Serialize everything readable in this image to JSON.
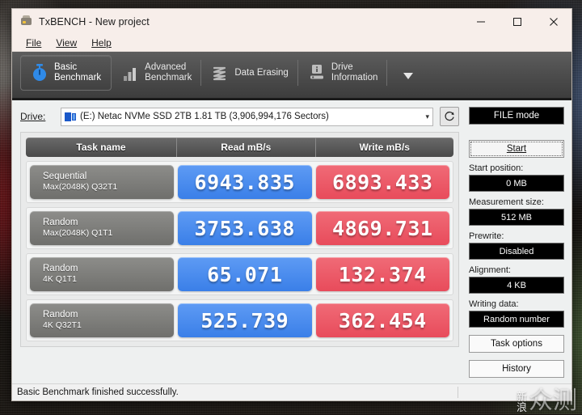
{
  "window": {
    "title": "TxBENCH - New project",
    "app_icon": "printer-icon",
    "controls": {
      "minimize": "minimize-icon",
      "maximize": "maximize-icon",
      "close": "close-icon"
    }
  },
  "menu": {
    "items": [
      "File",
      "View",
      "Help"
    ]
  },
  "tabs": [
    {
      "label": "Basic\nBenchmark",
      "icon": "stopwatch-icon",
      "active": true
    },
    {
      "label": "Advanced\nBenchmark",
      "icon": "bar-chart-icon",
      "active": false
    },
    {
      "label": "Data Erasing",
      "icon": "eraser-wave-icon",
      "active": false
    },
    {
      "label": "Drive\nInformation",
      "icon": "drive-info-icon",
      "active": false
    }
  ],
  "tab_overflow_icon": "chevron-down-icon",
  "drive": {
    "label": "Drive:",
    "value": "(E:) Netac NVMe SSD 2TB  1.81 TB (3,906,994,176 Sectors)",
    "dropdown_icon": "chevron-down-icon",
    "refresh_icon": "refresh-icon"
  },
  "table": {
    "headers": [
      "Task name",
      "Read mB/s",
      "Write mB/s"
    ],
    "rows": [
      {
        "task_line1": "Sequential",
        "task_line2": "Max(2048K) Q32T1",
        "read": "6943.835",
        "write": "6893.433"
      },
      {
        "task_line1": "Random",
        "task_line2": "Max(2048K) Q1T1",
        "read": "3753.638",
        "write": "4869.731"
      },
      {
        "task_line1": "Random",
        "task_line2": "4K Q1T1",
        "read": "65.071",
        "write": "132.374"
      },
      {
        "task_line1": "Random",
        "task_line2": "4K Q32T1",
        "read": "525.739",
        "write": "362.454"
      }
    ]
  },
  "sidebar": {
    "mode_button": "FILE mode",
    "start_button": "Start",
    "fields": [
      {
        "label": "Start position:",
        "value": "0 MB"
      },
      {
        "label": "Measurement size:",
        "value": "512 MB"
      },
      {
        "label": "Prewrite:",
        "value": "Disabled"
      },
      {
        "label": "Alignment:",
        "value": "4 KB"
      },
      {
        "label": "Writing data:",
        "value": "Random number"
      }
    ],
    "task_options_button": "Task options",
    "history_button": "History"
  },
  "status": {
    "text": "Basic Benchmark finished successfully."
  },
  "watermark": {
    "small_line1": "新",
    "small_line2": "浪",
    "big": "众测"
  },
  "colors": {
    "read_cell": "#3a7fe8",
    "write_cell": "#e84b5b",
    "tabstrip": "#4e4e4e",
    "accent_blue": "#1a58c9"
  }
}
